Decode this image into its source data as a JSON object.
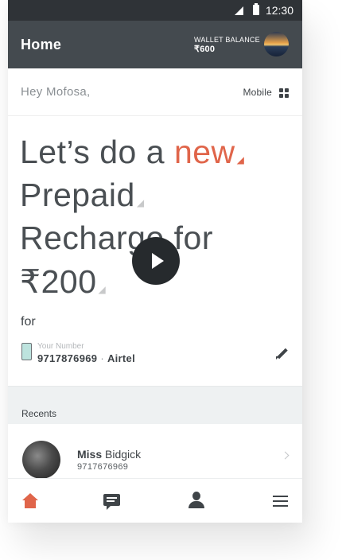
{
  "status_bar": {
    "time": "12:30"
  },
  "app_bar": {
    "title": "Home",
    "wallet_label": "WALLET BALANCE",
    "wallet_amount": "₹600"
  },
  "greeting": "Hey Mofosa,",
  "mode_label": "Mobile",
  "hero": {
    "line1_text": "Let’s do a ",
    "line1_accent": "new",
    "line2": "Prepaid",
    "line3": "Recharge for",
    "line4": "₹200",
    "for_label": "for"
  },
  "number": {
    "label": "Your Number",
    "value": "9717876969",
    "separator": "·",
    "operator": "Airtel"
  },
  "recents": {
    "header": "Recents",
    "items": [
      {
        "title": "Miss",
        "name": "Bidgick",
        "number": "9717676969"
      }
    ]
  },
  "colors": {
    "accent": "#e0654a",
    "app_bar": "#444a4f",
    "status_bar": "#2f3337"
  },
  "icons": [
    "signal-icon",
    "battery-icon",
    "grid-icon",
    "play-icon",
    "phone-icon",
    "edit-icon",
    "chevron-right-icon",
    "home-icon",
    "chat-icon",
    "profile-icon",
    "menu-icon"
  ]
}
